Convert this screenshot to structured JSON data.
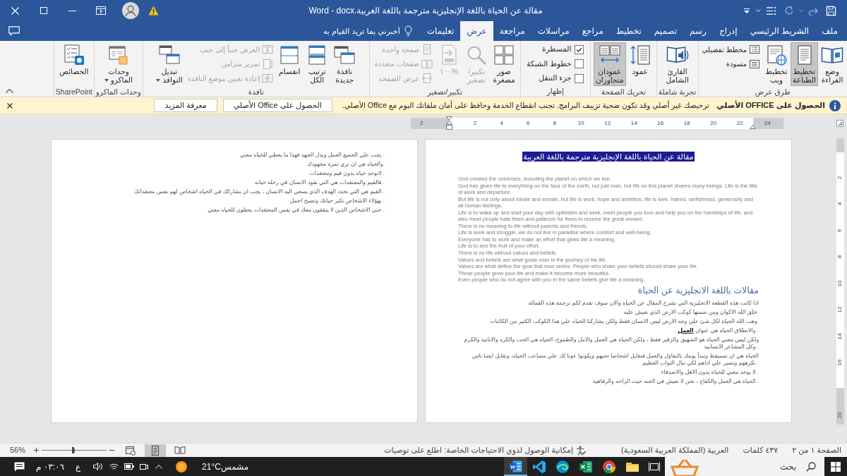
{
  "window": {
    "title": "مقالة عن الحياة باللغة الإنجليزية مترجمة باللغة العربية.docx ‏-‏ Word"
  },
  "tabs": [
    {
      "label": "ملف",
      "selected": false
    },
    {
      "label": "الشريط الرئيسي",
      "selected": false
    },
    {
      "label": "إدراج",
      "selected": false
    },
    {
      "label": "رسم",
      "selected": false
    },
    {
      "label": "تصميم",
      "selected": false
    },
    {
      "label": "تخطيط",
      "selected": false
    },
    {
      "label": "مراجع",
      "selected": false
    },
    {
      "label": "مراسلات",
      "selected": false
    },
    {
      "label": "مراجعة",
      "selected": false
    },
    {
      "label": "عرض",
      "selected": true
    },
    {
      "label": "تعليمات",
      "selected": false
    }
  ],
  "tell_me": {
    "placeholder": "أخبرني بما تريد القيام به"
  },
  "ribbon": {
    "groups": [
      {
        "label": "طرق عرض",
        "items": [
          {
            "kind": "large",
            "label": "وضع\nالقراءة",
            "selected": false
          },
          {
            "kind": "large",
            "label": "تخطيط\nالطباعة",
            "selected": true
          },
          {
            "kind": "large",
            "label": "تخطيط\nويب",
            "selected": false
          },
          {
            "kind": "small",
            "label": "مخطط تفصيلي",
            "selected": false
          },
          {
            "kind": "small",
            "label": "مسودة",
            "selected": false
          }
        ]
      },
      {
        "label": "تجربة شاملة",
        "items": [
          {
            "kind": "large",
            "label": "القارئ\nالشامل"
          }
        ]
      },
      {
        "label": "تحريك الصفحة",
        "items": [
          {
            "kind": "large",
            "label": "عمود",
            "selected": false
          },
          {
            "kind": "large",
            "label": "عمودان\nمتجاوران",
            "selected": true
          }
        ]
      },
      {
        "label": "إظهار",
        "items": [
          {
            "kind": "check",
            "label": "المسطرة",
            "checked": true
          },
          {
            "kind": "check",
            "label": "خطوط الشبكة",
            "checked": false
          },
          {
            "kind": "check",
            "label": "جزء التنقل",
            "checked": false
          }
        ]
      },
      {
        "label": "تكبير/تصغير",
        "items": [
          {
            "kind": "large",
            "label": "صور\nمصغرة",
            "disabled": false
          },
          {
            "kind": "large",
            "label": "تكبير/\nتصغير",
            "disabled": true
          },
          {
            "kind": "large",
            "label": "%١٠٠",
            "disabled": true
          },
          {
            "kind": "small",
            "label": "صفحة واحدة",
            "disabled": true
          },
          {
            "kind": "small",
            "label": "صفحات متعددة",
            "disabled": true
          },
          {
            "kind": "small",
            "label": "عرض الصفحة",
            "disabled": true
          }
        ]
      },
      {
        "label": "نافذة",
        "items": [
          {
            "kind": "large",
            "label": "نافذة\nجديدة",
            "disabled": false
          },
          {
            "kind": "large",
            "label": "ترتيب\nالكل",
            "disabled": false
          },
          {
            "kind": "large",
            "label": "انقسام",
            "disabled": false
          },
          {
            "kind": "small",
            "label": "العرض جنباً إلى جنب",
            "disabled": true
          },
          {
            "kind": "small",
            "label": "تمرير متزامن",
            "disabled": true
          },
          {
            "kind": "small",
            "label": "إعادة تعيين موضع النافذة",
            "disabled": true
          },
          {
            "kind": "large",
            "label": "تبديل\nالنوافذ",
            "disabled": false,
            "dropdown": true
          }
        ]
      },
      {
        "label": "وحدات الماكرو",
        "items": [
          {
            "kind": "large",
            "label": "وحدات\nالماكرو",
            "dropdown": true
          }
        ]
      },
      {
        "label": "SharePoint",
        "items": [
          {
            "kind": "large",
            "label": "الخصائص"
          }
        ]
      }
    ]
  },
  "info_bar": {
    "title": "الحصول على OFFICE الأصلي",
    "message": "ترخيصك غير أصلي وقد تكون ضحية تزييف البرامج. تجنب انقطاع الخدمة وحافظ على أمان ملفاتك اليوم مع Office الأصلي.",
    "buttons": [
      "الحصول على Office الأصلي",
      "معرفة المزيد"
    ]
  },
  "ruler": {
    "ticks": [
      "24",
      "22",
      "20",
      "18",
      "16",
      "14",
      "12",
      "10",
      "8",
      "6",
      "4",
      "2",
      "2"
    ]
  },
  "vertical_ruler": {
    "ticks": [
      "2",
      "4",
      "6",
      "8",
      "10",
      "12",
      "14",
      "16",
      "20"
    ]
  },
  "document": {
    "pages": [
      {
        "blocks": [
          {
            "kind": "title",
            "text": "مقالة عن الحياة باللغة الإنجليزية مترجمة باللغة العربية"
          },
          {
            "kind": "english",
            "text": "God created the universes, including the planet on which we live."
          },
          {
            "kind": "english",
            "text": "God has given life to everything on the face of the earth, not just man, but life on this planet shares many beings. Life is the title of work and departure."
          },
          {
            "kind": "english",
            "text": "But life is not only about inhale and exhale, but life is work, hope and ambition, life is love, hatred, selfishness, generosity and all human feelings."
          },
          {
            "kind": "english",
            "text": "Life is to wake up and start your day with optimism and work, meet people you love and help you on the hardships of life, and also meet people hate them and patience for them to receive the great reward."
          },
          {
            "kind": "english",
            "text": "There is no meaning to life without parents and friends."
          },
          {
            "kind": "english",
            "text": "Life is work and struggle, we do not live in paradise where comfort and well-being."
          },
          {
            "kind": "english",
            "text": "Everyone has to work and make an effort that gives life a meaning."
          },
          {
            "kind": "english",
            "text": "Life is to see the fruit of your effort."
          },
          {
            "kind": "english",
            "text": "There is no life without values and beliefs."
          },
          {
            "kind": "english",
            "text": "Values and beliefs are what guide man in the journey of his life."
          },
          {
            "kind": "english",
            "text": "Values are what define the goal that man seeks. People who share your beliefs should share your life."
          },
          {
            "kind": "english",
            "text": "These people grow your life and make it become more beautiful."
          },
          {
            "kind": "english",
            "text": "Even people who do not agree with you in the same beliefs give life a meaning."
          },
          {
            "kind": "heading",
            "text": "مقالات باللغة الانجليزية عن الحياة"
          },
          {
            "kind": "arabic",
            "text": "اذا كانت هذه القطعة الانجليزية التي تشرح المقال عن الحياة والان سوف تقدم لكم ترجمة هذه القمالة"
          },
          {
            "kind": "arabic",
            "text": "خلق الله الاكوان ومن ضمنها كوكب الارض الذي نعيش عليه."
          },
          {
            "kind": "arabic",
            "text": "وهب الله الحياة لكل شئ علي وجه الارض ليس الانسان فقط ولكن يشاركنا الحياه علي هذا الكوكب الكثير من الكائنات."
          },
          {
            "kind": "arabic",
            "text": "والانطلاق الحياه هي عنوان **العمل** ."
          },
          {
            "kind": "arabic",
            "text": "ولكن ليس معني الحياة هو الشهيق والزفير فقط ، ولكن الحياة هي العمل والامل والطموح، الحياه هي الحب والكره والانانيه والكرم وكل المشاعر الانسانيه ."
          },
          {
            "kind": "arabic",
            "text": "الحياة هي ان تستيقظ وتبدأ يومك بالتفاؤل والعمل فتقابل اشخاصا تحبهم ويكونوا عونا لك علي مصاعب الحياه، وتقابل ايضا ناس تكرههم وتصبر علي اذاهم لكي تنال الثواب العظيم ."
          },
          {
            "kind": "arabic",
            "text": "لا يوجد معني للحياة بدون الاهل والاصدقاء ."
          },
          {
            "kind": "arabic",
            "text": "الحياة هي العمل والكفاح ، نحن لا نعيش في الجنه حيث الراحه والرفاهيه ."
          }
        ]
      },
      {
        "blocks": [
          {
            "kind": "arabic",
            "text": "يجب علي الجميع العمل وبذل الجهد فهذا ما يعطي للحياه معني ."
          },
          {
            "kind": "arabic",
            "text": "والحياه هي ان تري ثمرة مجهودك."
          },
          {
            "kind": "arabic",
            "text": "لاتوجد حياة بدون قيم ومعتقدات ."
          },
          {
            "kind": "arabic",
            "text": "فالقيم والمعتقدات هي التي تقود الانسان في رحلة حياته ."
          },
          {
            "kind": "arabic",
            "text": "القيم هي التي تحدد الهدف الذي يسعي اليه الانسان ، يجب ان يشاركك في الحياه اشخاص لهم نفس معتقداتك ."
          },
          {
            "kind": "arabic",
            "text": "بهؤلاء الاشخاص تكبر حياتك وتصبح احمل ."
          },
          {
            "kind": "arabic",
            "text": "حتي الاشخاص الذين لا يتفقون معك في نفس المعتقدات يعطون للحياه معني ."
          }
        ]
      }
    ]
  },
  "status_bar": {
    "page": "الصفحة ١ من ٢",
    "words": "٤٣٧ كلمات",
    "language": "العربية (المملكة العربية السعودية)",
    "accessibility": "إمكانية الوصول لذوي الاحتياجات الخاصة: اطلع على توصيات",
    "views": [
      {
        "selected": false
      },
      {
        "selected": true
      },
      {
        "selected": false
      }
    ],
    "zoom": {
      "level": 0.52,
      "reading": "56%"
    }
  },
  "taskbar": {
    "search": {
      "placeholder": "بحث"
    },
    "apps": [
      {
        "active": false
      },
      {
        "active": false
      },
      {
        "active": false
      },
      {
        "active": false
      },
      {
        "active": false
      },
      {
        "active": true
      }
    ],
    "weather": {
      "condition": "مشمس",
      "temperature": "21°C"
    },
    "language": "ع",
    "time": "٠٣:٠٦ م"
  }
}
